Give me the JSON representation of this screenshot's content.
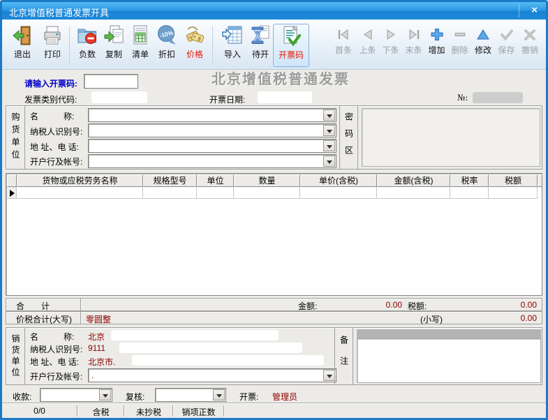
{
  "colors": {
    "title_bar_blue": "#2d9ae4",
    "window_border_blue": "#1b7ac8",
    "toolbar_red_label": "#e81500",
    "value_dark_red": "#8b0000",
    "prompt_blue": "#0000c8",
    "watermark_gray": "#9b9b9b"
  },
  "window": {
    "title": "北京增值税普通发票开具",
    "close_glyph": "×"
  },
  "toolbar": {
    "buttons": [
      {
        "label": "退出",
        "icon": "exit-door"
      },
      {
        "label": "打印",
        "icon": "printer"
      },
      {
        "label": "负数",
        "icon": "folder-minus"
      },
      {
        "label": "复制",
        "icon": "copy-pages"
      },
      {
        "label": "清单",
        "icon": "list-sheet"
      },
      {
        "label": "折扣",
        "icon": "discount-10"
      },
      {
        "label": "价格",
        "icon": "price-tags"
      },
      {
        "label": "导入",
        "icon": "import-table"
      },
      {
        "label": "待开",
        "icon": "hourglass"
      },
      {
        "label": "开票码",
        "icon": "invoice-code-check"
      }
    ],
    "nav": [
      {
        "label": "首条",
        "disabled": true
      },
      {
        "label": "上条",
        "disabled": true
      },
      {
        "label": "下条",
        "disabled": true
      },
      {
        "label": "末条",
        "disabled": true
      },
      {
        "label": "增加",
        "disabled": false
      },
      {
        "label": "删除",
        "disabled": true
      },
      {
        "label": "修改",
        "disabled": false
      },
      {
        "label": "保存",
        "disabled": true
      },
      {
        "label": "撤销",
        "disabled": true
      }
    ]
  },
  "header": {
    "code_prompt": "请输入开票码:",
    "code_value": "",
    "watermark": "北京增值税普通发票",
    "category_label": "发票类别代码:",
    "date_label": "开票日期:",
    "number_label": "№:"
  },
  "buyer": {
    "group_label": "购货单位",
    "fields": [
      {
        "label": "名　　　称:",
        "value": ""
      },
      {
        "label": "纳税人识别号:",
        "value": ""
      },
      {
        "label": "地 址、电 话:",
        "value": ""
      },
      {
        "label": "开户行及帐号:",
        "value": ""
      }
    ],
    "password_label": "密码区"
  },
  "items_table": {
    "columns": [
      "货物或应税劳务名称",
      "规格型号",
      "单位",
      "数量",
      "单价(含税)",
      "金额(含税)",
      "税率",
      "税额"
    ],
    "rows": [
      [
        "",
        "",
        "",
        "",
        "",
        "",
        "",
        ""
      ]
    ]
  },
  "totals": {
    "total_label": "合　　计",
    "amount_label": "金额:",
    "amount_value": "0.00",
    "tax_label": "税额:",
    "tax_value": "0.00",
    "grand_label": "价税合计(大写)",
    "grand_words": "零圆整",
    "small_label": "(小写)",
    "small_value": "0.00"
  },
  "seller": {
    "group_label": "销货单位",
    "fields": [
      {
        "label": "名　　　称:",
        "value": "北京"
      },
      {
        "label": "纳税人识别号:",
        "value": "9111"
      },
      {
        "label": "地 址、电 话:",
        "value": "北京市."
      },
      {
        "label": "开户行及帐号:",
        "value": "."
      }
    ],
    "remark_label": "备注"
  },
  "footer": {
    "payee_label": "收款:",
    "payee_value": "",
    "reviewer_label": "复核:",
    "reviewer_value": "",
    "drawer_label": "开票:",
    "drawer_value": "管理员"
  },
  "statusbar": {
    "cells": [
      "0/0",
      "含税",
      "未抄税",
      "销项正数"
    ]
  }
}
